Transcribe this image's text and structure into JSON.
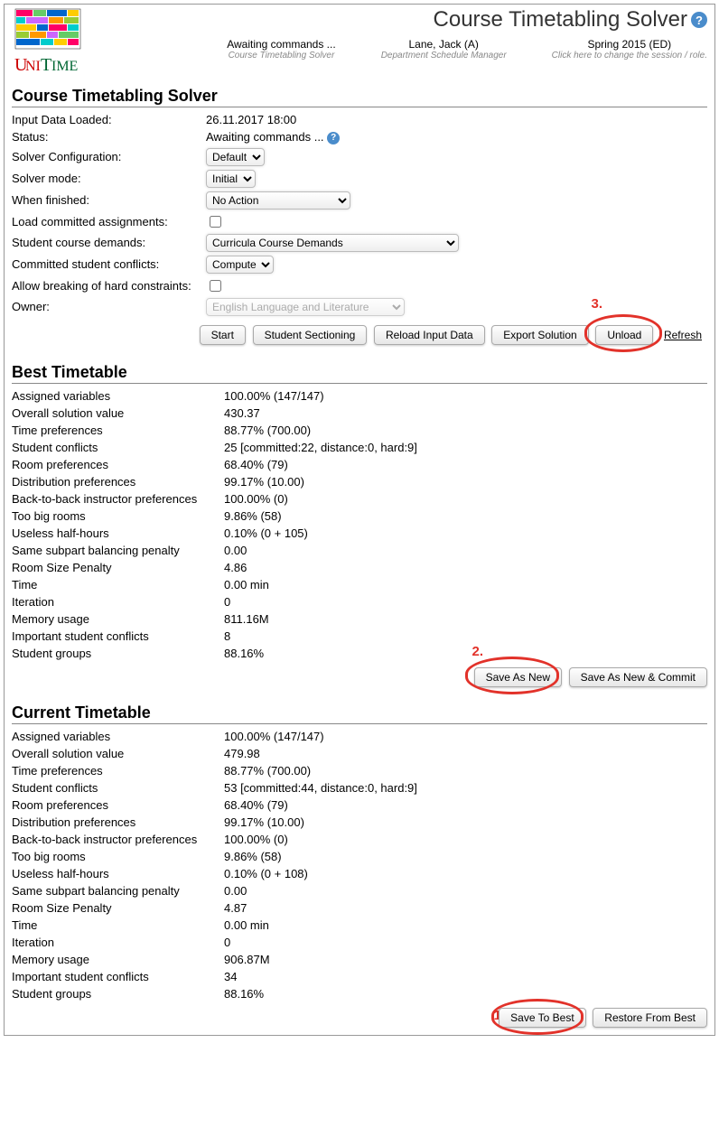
{
  "header": {
    "page_title": "Course Timetabling Solver",
    "session": {
      "status": "Awaiting commands ...",
      "status_sub": "Course Timetabling Solver",
      "user": "Lane, Jack (A)",
      "user_sub": "Department Schedule Manager",
      "term": "Spring 2015 (ED)",
      "term_sub": "Click here to change the session / role."
    }
  },
  "sections": {
    "solver_heading": "Course Timetabling Solver",
    "best_heading": "Best Timetable",
    "current_heading": "Current Timetable"
  },
  "solver_form": {
    "input_loaded_label": "Input Data Loaded:",
    "input_loaded_value": "26.11.2017 18:00",
    "status_label": "Status:",
    "status_value": "Awaiting commands ...",
    "config_label": "Solver Configuration:",
    "config_value": "Default",
    "mode_label": "Solver mode:",
    "mode_value": "Initial",
    "when_finished_label": "When finished:",
    "when_finished_value": "No Action",
    "load_committed_label": "Load committed assignments:",
    "demands_label": "Student course demands:",
    "demands_value": "Curricula Course Demands",
    "conflicts_label": "Committed student conflicts:",
    "conflicts_value": "Compute",
    "allow_break_label": "Allow breaking of hard constraints:",
    "owner_label": "Owner:",
    "owner_value": "English Language and Literature"
  },
  "solver_buttons": {
    "start": "Start",
    "student_sectioning": "Student Sectioning",
    "reload": "Reload Input Data",
    "export": "Export Solution",
    "unload": "Unload",
    "refresh": "Refresh"
  },
  "best": {
    "rows": [
      {
        "label": "Assigned variables",
        "value": "100.00% (147/147)"
      },
      {
        "label": "Overall solution value",
        "value": "430.37"
      },
      {
        "label": "Time preferences",
        "value": "88.77% (700.00)"
      },
      {
        "label": "Student conflicts",
        "value": "25 [committed:22, distance:0, hard:9]"
      },
      {
        "label": "Room preferences",
        "value": "68.40% (79)"
      },
      {
        "label": "Distribution preferences",
        "value": "99.17% (10.00)"
      },
      {
        "label": "Back-to-back instructor preferences",
        "value": "100.00% (0)"
      },
      {
        "label": "Too big rooms",
        "value": "9.86% (58)"
      },
      {
        "label": "Useless half-hours",
        "value": "0.10% (0 + 105)"
      },
      {
        "label": "Same subpart balancing penalty",
        "value": "0.00"
      },
      {
        "label": "Room Size Penalty",
        "value": "4.86"
      },
      {
        "label": "Time",
        "value": "0.00 min"
      },
      {
        "label": "Iteration",
        "value": "0"
      },
      {
        "label": "Memory usage",
        "value": "811.16M"
      },
      {
        "label": "Important student conflicts",
        "value": "8"
      },
      {
        "label": "Student groups",
        "value": "88.16%"
      }
    ],
    "buttons": {
      "save_as_new": "Save As New",
      "save_as_new_commit": "Save As New & Commit"
    }
  },
  "current": {
    "rows": [
      {
        "label": "Assigned variables",
        "value": "100.00% (147/147)"
      },
      {
        "label": "Overall solution value",
        "value": "479.98"
      },
      {
        "label": "Time preferences",
        "value": "88.77% (700.00)"
      },
      {
        "label": "Student conflicts",
        "value": "53 [committed:44, distance:0, hard:9]"
      },
      {
        "label": "Room preferences",
        "value": "68.40% (79)"
      },
      {
        "label": "Distribution preferences",
        "value": "99.17% (10.00)"
      },
      {
        "label": "Back-to-back instructor preferences",
        "value": "100.00% (0)"
      },
      {
        "label": "Too big rooms",
        "value": "9.86% (58)"
      },
      {
        "label": "Useless half-hours",
        "value": "0.10% (0 + 108)"
      },
      {
        "label": "Same subpart balancing penalty",
        "value": "0.00"
      },
      {
        "label": "Room Size Penalty",
        "value": "4.87"
      },
      {
        "label": "Time",
        "value": "0.00 min"
      },
      {
        "label": "Iteration",
        "value": "0"
      },
      {
        "label": "Memory usage",
        "value": "906.87M"
      },
      {
        "label": "Important student conflicts",
        "value": "34"
      },
      {
        "label": "Student groups",
        "value": "88.16%"
      }
    ],
    "buttons": {
      "save_to_best": "Save To Best",
      "restore_from_best": "Restore From Best"
    }
  },
  "annotations": {
    "a1": "1.",
    "a2": "2.",
    "a3": "3."
  }
}
